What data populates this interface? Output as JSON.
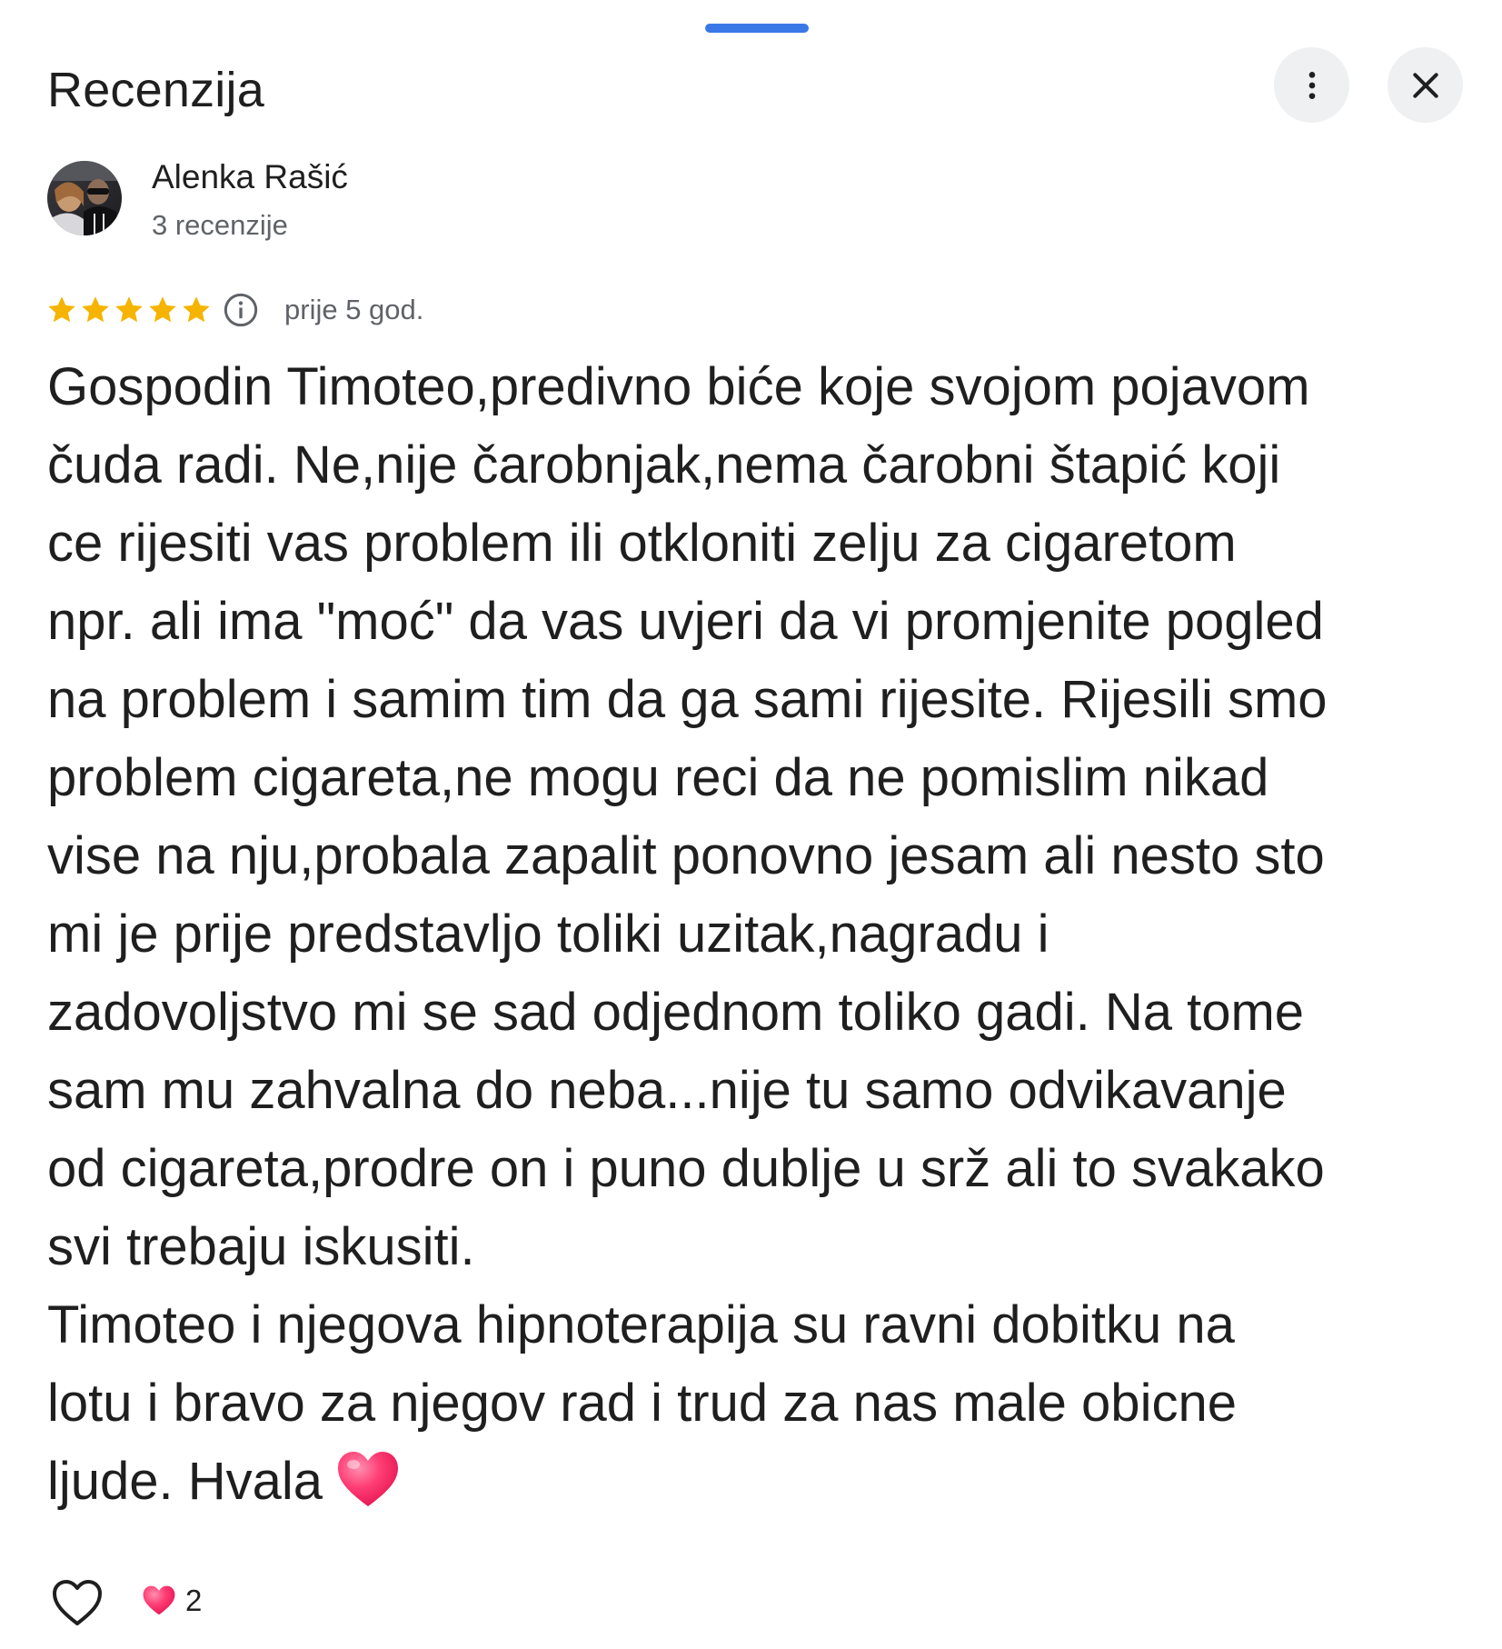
{
  "header": {
    "title": "Recenzija",
    "more_icon": "more-vert-icon",
    "close_icon": "close-icon"
  },
  "author": {
    "name": "Alenka Rašić",
    "meta": "3 recenzije"
  },
  "review": {
    "rating": 5,
    "max_rating": 5,
    "date": "prije 5 god.",
    "text": "Gospodin Timoteo,predivno biće koje svojom pojavom\nčuda radi. Ne,nije čarobnjak,nema čarobni štapić koji\nce rijesiti vas problem ili otkloniti zelju za cigaretom\nnpr. ali ima \"moć\" da vas uvjeri da vi promjenite pogled\nna problem i samim tim da ga sami rijesite. Rijesili smo\nproblem cigareta,ne mogu reci da ne pomislim nikad\nvise na nju,probala zapalit ponovno jesam ali nesto sto\nmi je prije predstavljo toliki uzitak,nagradu i\nzadovoljstvo mi se sad odjednom toliko gadi. Na tome\nsam mu zahvalna do neba...nije tu samo odvikavanje\nod cigareta,prodre on i puno dublje u srž ali to svakako\nsvi trebaju iskusiti.\nTimoteo i njegova hipnoterapija su ravni dobitku na\nlotu i bravo za njegov rad i trud za nas male obicne\nljude. Hvala"
  },
  "reactions": {
    "count": "2"
  },
  "colors": {
    "accent": "#3b78e7",
    "star": "#f6b400",
    "heart": "#ff2d6a",
    "secondary_text": "#5f6368",
    "button_bg": "#eef0f2"
  }
}
